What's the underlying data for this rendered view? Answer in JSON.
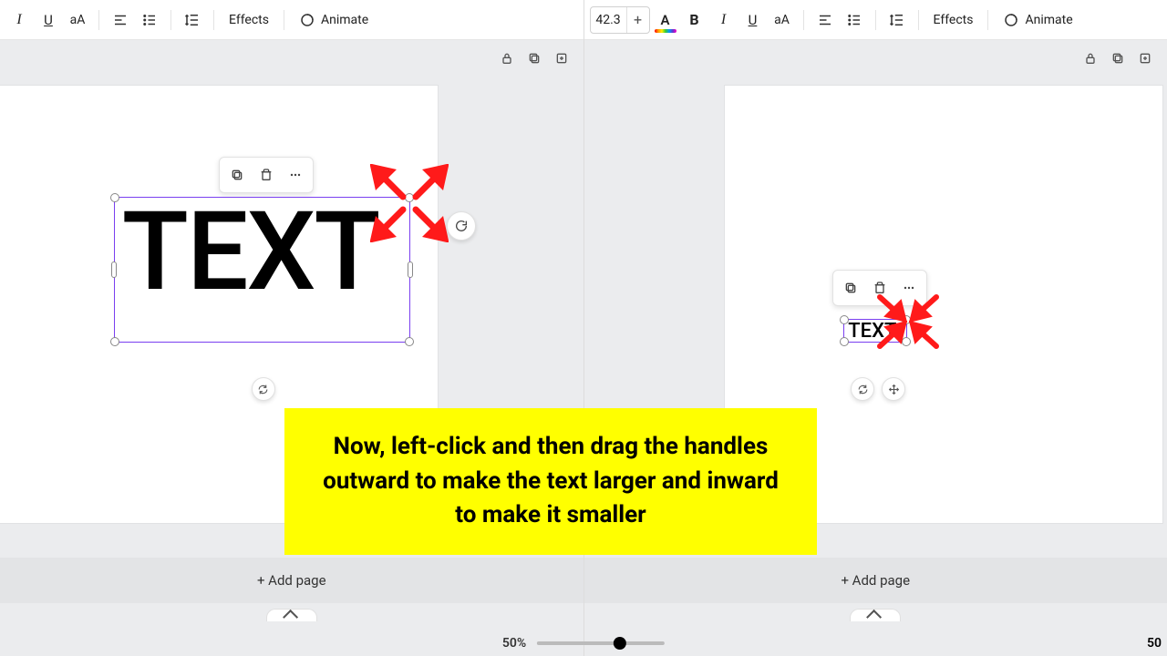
{
  "toolbar": {
    "font_size_value": "42.3",
    "effects_label": "Effects",
    "animate_label": "Animate",
    "italic_glyph": "I",
    "underline_glyph": "U",
    "case_glyph": "aA",
    "bold_glyph": "B",
    "textcolor_glyph": "A"
  },
  "canvas": {
    "text_content": "TEXT",
    "add_page_label": "+ Add page"
  },
  "zoom": {
    "label_left": "50%",
    "label_right_partial": "50",
    "knob_percent": 60
  },
  "callout": {
    "text": "Now, left-click and then drag the handles outward to make the text larger and inward to make it smaller"
  }
}
